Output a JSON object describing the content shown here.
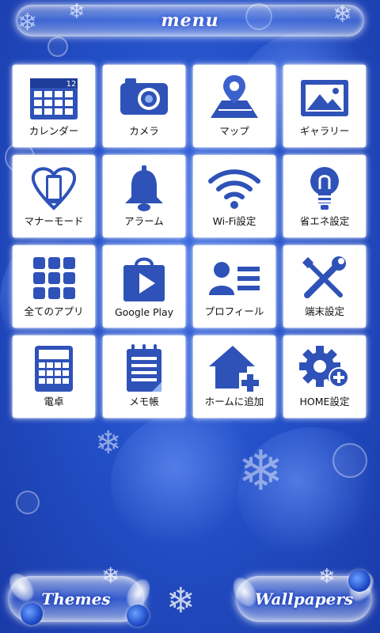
{
  "header": {
    "title": "menu"
  },
  "tiles": [
    {
      "label": "カレンダー",
      "icon": "calendar-icon",
      "badge": "12"
    },
    {
      "label": "カメラ",
      "icon": "camera-icon"
    },
    {
      "label": "マップ",
      "icon": "map-pin-icon"
    },
    {
      "label": "ギャラリー",
      "icon": "gallery-icon"
    },
    {
      "label": "マナーモード",
      "icon": "manner-mode-icon"
    },
    {
      "label": "アラーム",
      "icon": "bell-icon"
    },
    {
      "label": "Wi-Fi設定",
      "icon": "wifi-icon"
    },
    {
      "label": "省エネ設定",
      "icon": "lightbulb-icon"
    },
    {
      "label": "全てのアプリ",
      "icon": "app-grid-icon"
    },
    {
      "label": "Google Play",
      "icon": "play-store-icon"
    },
    {
      "label": "プロフィール",
      "icon": "profile-card-icon"
    },
    {
      "label": "端末設定",
      "icon": "tools-icon"
    },
    {
      "label": "電卓",
      "icon": "calculator-icon"
    },
    {
      "label": "メモ帳",
      "icon": "notepad-icon"
    },
    {
      "label": "ホームに追加",
      "icon": "home-add-icon"
    },
    {
      "label": "HOME設定",
      "icon": "gear-add-icon"
    }
  ],
  "footer": {
    "themes_label": "Themes",
    "wallpapers_label": "Wallpapers"
  },
  "colors": {
    "icon_blue": "#2f52b8",
    "background": "#2350c8",
    "tile": "#ffffff"
  }
}
